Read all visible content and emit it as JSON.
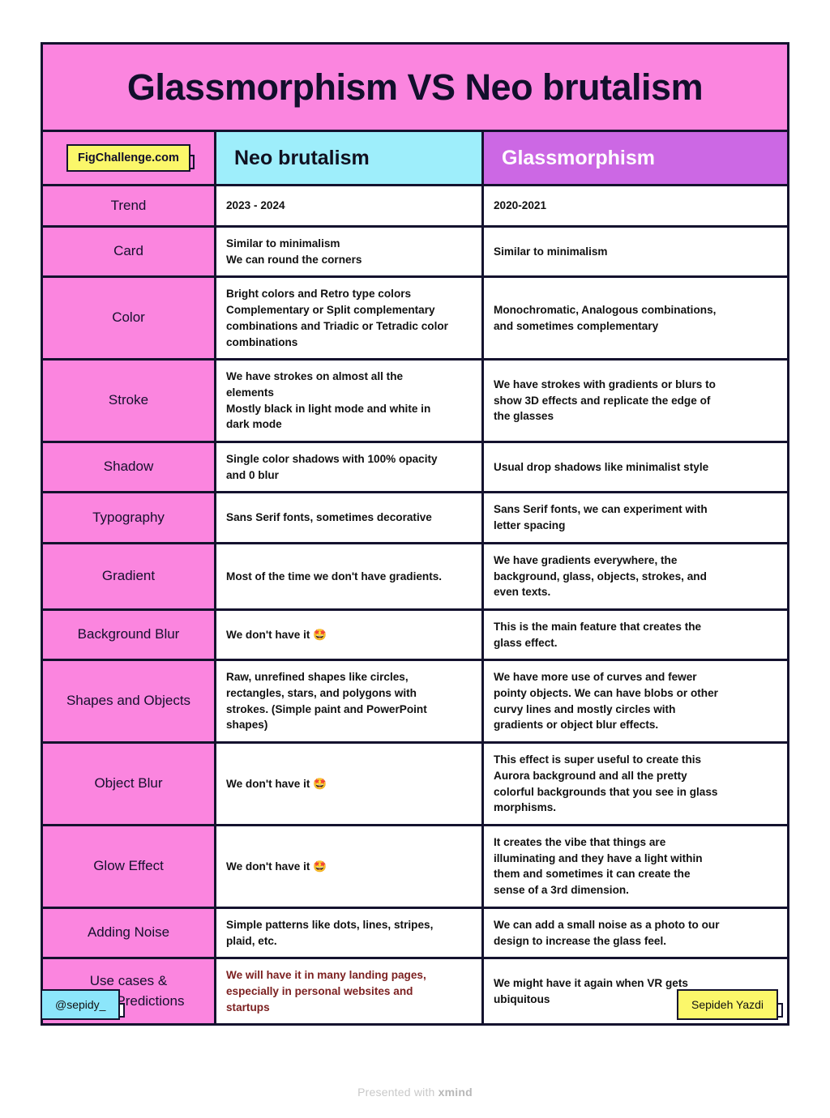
{
  "title": "Glassmorphism VS Neo brutalism",
  "brand_badge": "FigChallenge.com",
  "columns": {
    "label_header": "",
    "neo_brutalism": "Neo brutalism",
    "glassmorphism": "Glassmorphism"
  },
  "colors": {
    "pink": "#fb85df",
    "cyan": "#9eeefb",
    "purple": "#cc68e4",
    "yellow": "#fbf76a",
    "light_cyan": "#8ce6fb",
    "ink": "#14122e",
    "accent_text": "#7c2020"
  },
  "rows": [
    {
      "label": "Trend",
      "neo": "2023 - 2024",
      "glass": "2020-2021",
      "neo_accent": false
    },
    {
      "label": "Card",
      "neo": "Similar to minimalism\nWe can round the corners",
      "glass": "Similar to minimalism",
      "neo_accent": false
    },
    {
      "label": "Color",
      "neo": "Bright colors and Retro type colors\nComplementary or Split complementary\ncombinations and Triadic or Tetradic color\ncombinations",
      "glass": "Monochromatic, Analogous combinations,\nand sometimes complementary",
      "neo_accent": false
    },
    {
      "label": "Stroke",
      "neo": "We have strokes on almost all the\nelements\nMostly black in light mode and white in\ndark mode",
      "glass": "We have strokes with gradients or blurs to\nshow 3D effects and replicate the edge of\nthe glasses",
      "neo_accent": false
    },
    {
      "label": "Shadow",
      "neo": "Single color shadows with 100% opacity\nand 0 blur",
      "glass": "Usual drop shadows like minimalist style",
      "neo_accent": false
    },
    {
      "label": "Typography",
      "neo": "Sans Serif fonts, sometimes decorative",
      "glass": "Sans Serif fonts, we can experiment with\nletter spacing",
      "neo_accent": false
    },
    {
      "label": "Gradient",
      "neo": "Most of the time we don't have gradients.",
      "glass": "We have gradients everywhere, the\nbackground, glass, objects, strokes, and\neven texts.",
      "neo_accent": false
    },
    {
      "label": "Background Blur",
      "neo": "We don't have it 🤩",
      "glass": "This is the main feature that creates the\nglass effect.",
      "neo_accent": false
    },
    {
      "label": "Shapes and Objects",
      "neo": "Raw, unrefined shapes like circles,\nrectangles, stars, and polygons with\nstrokes. (Simple paint and PowerPoint\nshapes)",
      "glass": "We have more use of curves and fewer\npointy objects. We can have blobs or other\ncurvy lines and mostly circles with\ngradients or object blur effects.",
      "neo_accent": false
    },
    {
      "label": "Object Blur",
      "neo": "We don't have it 🤩",
      "glass": "This effect is super useful to create this\nAurora background and all the pretty\ncolorful backgrounds that you see in glass\nmorphisms.",
      "neo_accent": false
    },
    {
      "label": "Glow Effect",
      "neo": "We don't have it 🤩",
      "glass": "It creates the vibe that things are\nilluminating and they have a light within\nthem and sometimes it can create the\nsense of a 3rd dimension.",
      "neo_accent": false
    },
    {
      "label": "Adding Noise",
      "neo": "Simple patterns like dots, lines, stripes,\nplaid, etc.",
      "glass": "We can add a small noise as a photo to our\ndesign to increase the glass feel.",
      "neo_accent": false
    },
    {
      "label": "Use cases &\nFuture Predictions",
      "neo": "We will have it in many landing pages,\nespecially in personal websites and\nstartups",
      "glass": "We might have it again when VR gets\nubiquitous",
      "neo_accent": true
    }
  ],
  "footer": {
    "handle": "@sepidy_",
    "author": "Sepideh Yazdi"
  },
  "watermark": {
    "prefix": "Presented with ",
    "brand": "xmind"
  }
}
